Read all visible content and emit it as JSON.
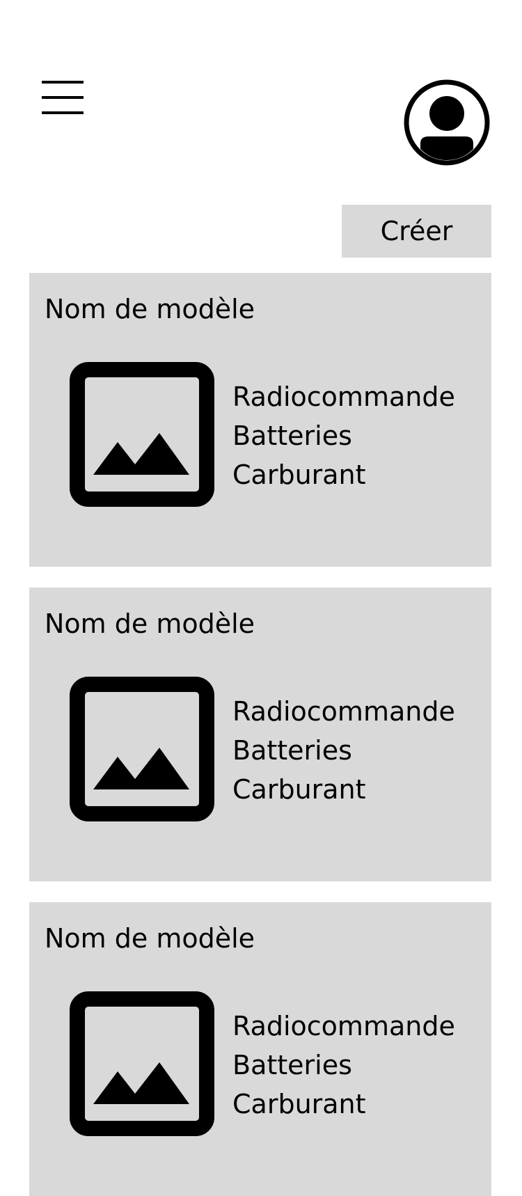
{
  "header": {
    "menu_icon": "hamburger-menu-icon",
    "profile_icon": "user-avatar-icon"
  },
  "actions": {
    "create_label": "Créer"
  },
  "cards": [
    {
      "title": "Nom de modèle",
      "image_icon": "image-placeholder-icon",
      "features": [
        "Radiocommande",
        "Batteries",
        "Carburant"
      ]
    },
    {
      "title": "Nom de modèle",
      "image_icon": "image-placeholder-icon",
      "features": [
        "Radiocommande",
        "Batteries",
        "Carburant"
      ]
    },
    {
      "title": "Nom de modèle",
      "image_icon": "image-placeholder-icon",
      "features": [
        "Radiocommande",
        "Batteries",
        "Carburant"
      ]
    }
  ],
  "colors": {
    "background": "#ffffff",
    "card_background": "#d9d9d9",
    "foreground": "#000000"
  }
}
